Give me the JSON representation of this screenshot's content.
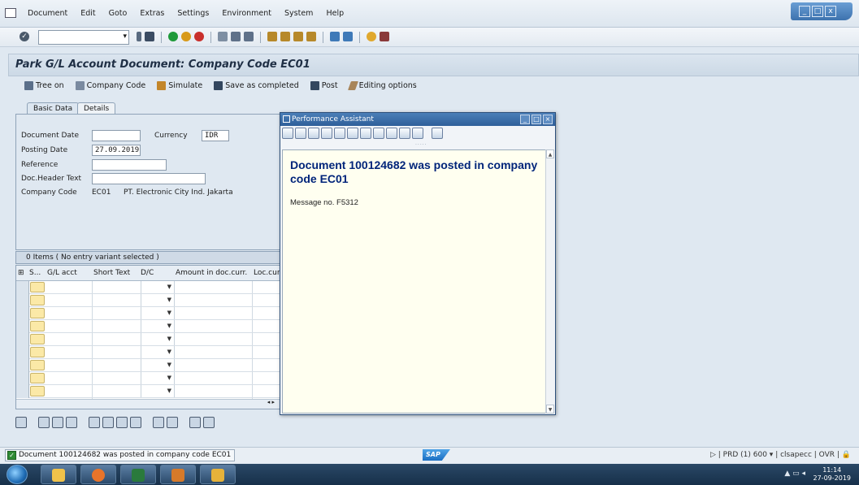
{
  "menubar": {
    "items": [
      "Document",
      "Edit",
      "Goto",
      "Extras",
      "Settings",
      "Environment",
      "System",
      "Help"
    ]
  },
  "window_controls": [
    "_",
    "□",
    "x"
  ],
  "transaction": {
    "title": "Park G/L Account Document: Company Code EC01"
  },
  "app_toolbar": {
    "tree_on": "Tree on",
    "company_code": "Company Code",
    "simulate": "Simulate",
    "save_completed": "Save as completed",
    "post": "Post",
    "editing_options": "Editing options"
  },
  "tabs": {
    "basic_data": "Basic Data",
    "details": "Details"
  },
  "form": {
    "document_date_label": "Document Date",
    "document_date_value": "",
    "currency_label": "Currency",
    "currency_value": "IDR",
    "posting_date_label": "Posting Date",
    "posting_date_value": "27.09.2019",
    "reference_label": "Reference",
    "reference_value": "",
    "doc_header_label": "Doc.Header Text",
    "doc_header_value": "",
    "company_code_label": "Company Code",
    "company_code_value": "EC01",
    "company_name": "PT. Electronic City Ind. Jakarta"
  },
  "items": {
    "header": "0 Items ( No entry variant selected )",
    "columns": [
      "S...",
      "G/L acct",
      "Short Text",
      "D/C",
      "Amount in doc.curr.",
      "Loc.curr"
    ]
  },
  "dialog": {
    "title": "Performance Assistant",
    "message": "Document 100124682 was posted in company code EC01",
    "message_no": "Message no. F5312",
    "dots": "....."
  },
  "status": {
    "message": "Document 100124682 was posted in company code EC01",
    "sap_logo": "SAP",
    "system": "PRD (1) 600",
    "user": "clsapecc",
    "mode": "OVR"
  },
  "taskbar": {
    "time": "11:14",
    "date": "27-09-2019"
  },
  "colors": {
    "title_bar": "#4b7fb8",
    "dialog_text": "#00247a",
    "status_ok": "#2f8a34"
  }
}
